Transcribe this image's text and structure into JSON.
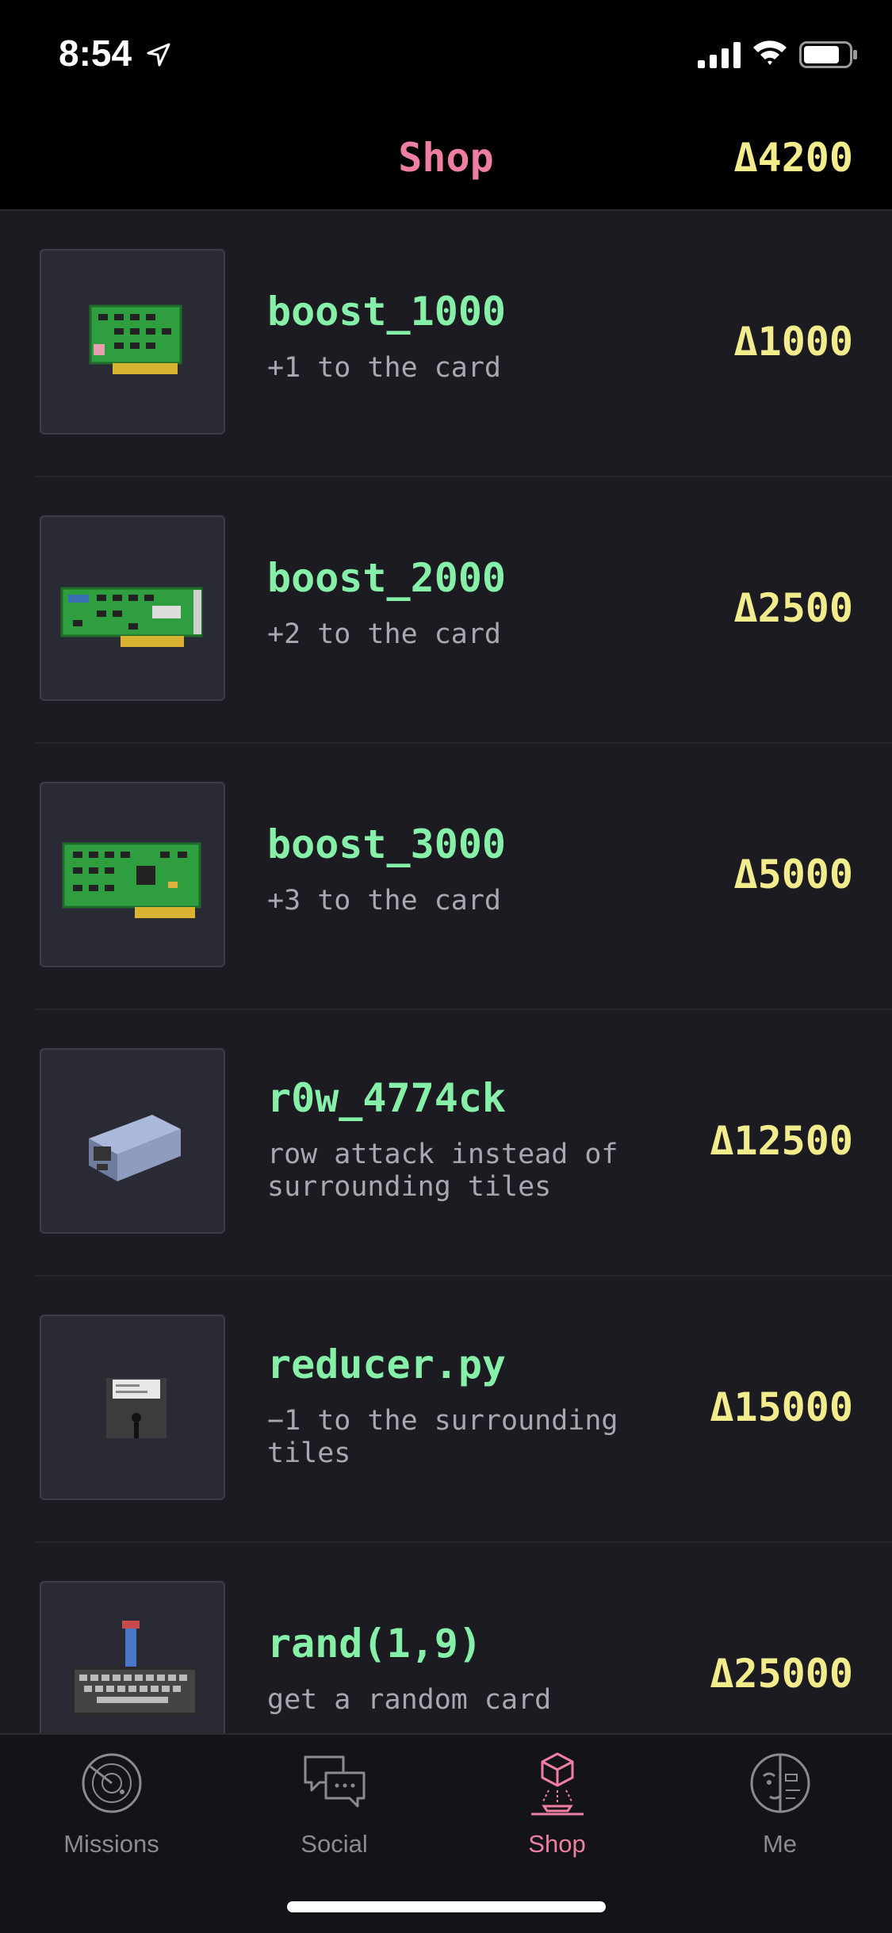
{
  "status_bar": {
    "time": "8:54"
  },
  "nav": {
    "title": "Shop",
    "balance": "Δ4200"
  },
  "items": [
    {
      "name": "boost_1000",
      "desc": "+1 to the card",
      "price": "Δ1000",
      "icon": "green-circuit-card-small"
    },
    {
      "name": "boost_2000",
      "desc": "+2 to the card",
      "price": "Δ2500",
      "icon": "green-circuit-card-medium"
    },
    {
      "name": "boost_3000",
      "desc": "+3 to the card",
      "price": "Δ5000",
      "icon": "green-circuit-card-large"
    },
    {
      "name": "r0w_4774ck",
      "desc": "row attack instead of surrounding tiles",
      "price": "Δ12500",
      "icon": "power-supply-box"
    },
    {
      "name": "reducer.py",
      "desc": "−1 to the surrounding tiles",
      "price": "Δ15000",
      "icon": "floppy-disk"
    },
    {
      "name": "rand(1,9)",
      "desc": "get a random card",
      "price": "Δ25000",
      "icon": "keyboard-with-joystick"
    }
  ],
  "tabs": [
    {
      "label": "Missions",
      "icon": "radar-icon"
    },
    {
      "label": "Social",
      "icon": "chat-bubbles-icon"
    },
    {
      "label": "Shop",
      "icon": "hologram-cube-icon"
    },
    {
      "label": "Me",
      "icon": "face-icon"
    }
  ],
  "colors": {
    "accent": "#ee7fa3",
    "currency": "#f3ec8d",
    "item_name": "#86f0a8"
  }
}
